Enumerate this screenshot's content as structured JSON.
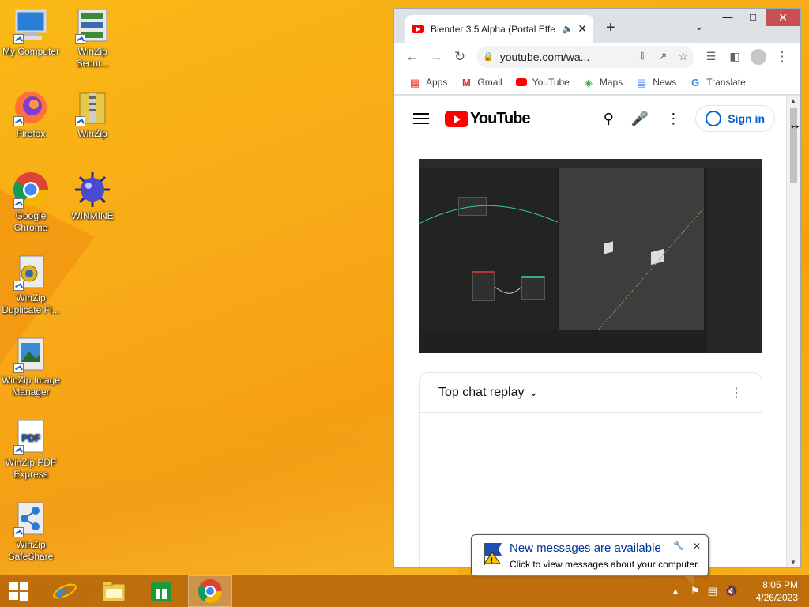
{
  "desktop": {
    "icons": [
      {
        "label": "My Computer"
      },
      {
        "label": "WinZip Secur..."
      },
      {
        "label": "Firefox"
      },
      {
        "label": "WinZip"
      },
      {
        "label": "Google Chrome"
      },
      {
        "label": "WINMINE"
      },
      {
        "label": "WinZip Duplicate Fi..."
      },
      {
        "label": "WinZip Image Manager"
      },
      {
        "label": "WinZip PDF Express"
      },
      {
        "label": "WinZip SafeShare"
      }
    ]
  },
  "browser": {
    "tab_title": "Blender 3.5 Alpha (Portal Effe",
    "address": "youtube.com/wa...",
    "bookmarks": [
      "Apps",
      "Gmail",
      "YouTube",
      "Maps",
      "News",
      "Translate"
    ],
    "youtube": {
      "wordmark": "YouTube",
      "sign_in": "Sign in",
      "chat_header": "Top chat replay"
    }
  },
  "notification": {
    "title": "New messages are available",
    "subtitle": "Click to view messages about your computer."
  },
  "taskbar": {
    "time": "8:05 PM",
    "date": "4/26/2023"
  },
  "colors": {
    "desktop": "#f8a817",
    "youtube_red": "#ff0000",
    "sign_in_blue": "#065fd4"
  }
}
